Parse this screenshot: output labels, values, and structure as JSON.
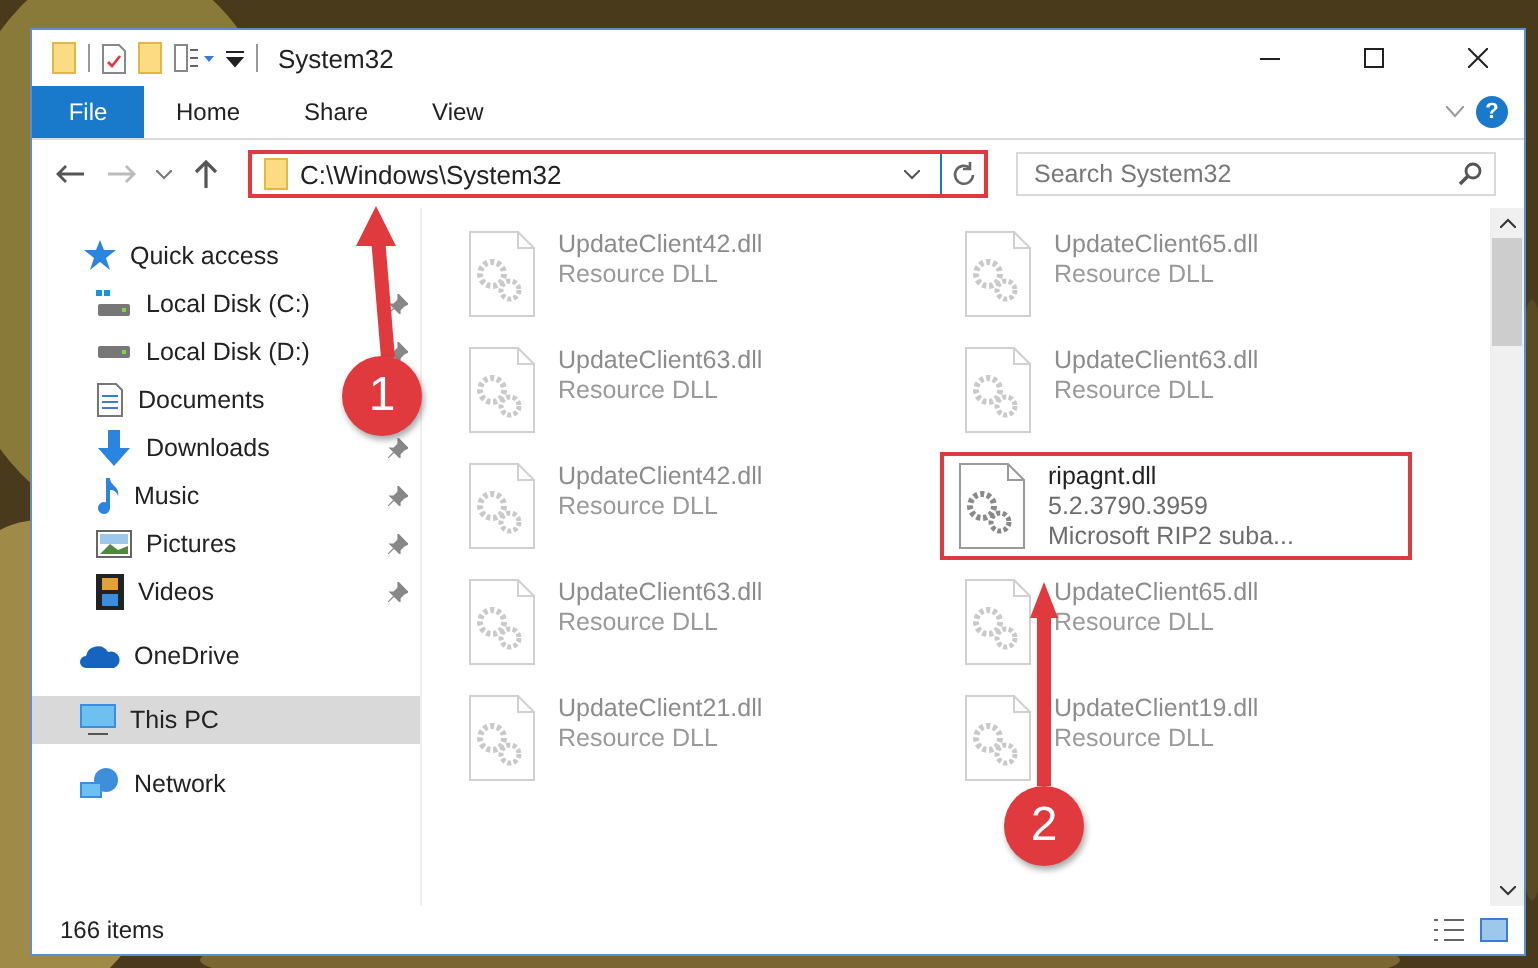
{
  "window": {
    "title": "System32"
  },
  "ribbon": {
    "tabs": [
      {
        "label": "File",
        "selected": true
      },
      {
        "label": "Home",
        "selected": false
      },
      {
        "label": "Share",
        "selected": false
      },
      {
        "label": "View",
        "selected": false
      }
    ],
    "help": "?"
  },
  "address": {
    "path": "C:\\Windows\\System32",
    "highlighted": true
  },
  "search": {
    "placeholder": "Search System32"
  },
  "sidebar": {
    "items": [
      {
        "label": "Quick access",
        "selected": false,
        "children": [
          {
            "label": "Local Disk (C:)",
            "pinned": true
          },
          {
            "label": "Local Disk (D:)",
            "pinned": true
          },
          {
            "label": "Documents",
            "pinned": false
          },
          {
            "label": "Downloads",
            "pinned": true
          },
          {
            "label": "Music",
            "pinned": true
          },
          {
            "label": "Pictures",
            "pinned": true
          },
          {
            "label": "Videos",
            "pinned": true
          }
        ]
      },
      {
        "label": "OneDrive",
        "selected": false
      },
      {
        "label": "This PC",
        "selected": true
      },
      {
        "label": "Network",
        "selected": false
      }
    ]
  },
  "files": [
    {
      "name": "UpdateClient42.dll",
      "details": [
        "Resource DLL"
      ],
      "blurred": true,
      "highlighted": false
    },
    {
      "name": "UpdateClient65.dll",
      "details": [
        "Resource DLL"
      ],
      "blurred": true,
      "highlighted": false
    },
    {
      "name": "UpdateClient63.dll",
      "details": [
        "Resource DLL"
      ],
      "blurred": true,
      "highlighted": false
    },
    {
      "name": "UpdateClient63.dll",
      "details": [
        "Resource DLL"
      ],
      "blurred": true,
      "highlighted": false
    },
    {
      "name": "UpdateClient42.dll",
      "details": [
        "Resource DLL"
      ],
      "blurred": true,
      "highlighted": false
    },
    {
      "name": "ripagnt.dll",
      "details": [
        "5.2.3790.3959",
        "Microsoft RIP2 suba..."
      ],
      "blurred": false,
      "highlighted": true
    },
    {
      "name": "UpdateClient63.dll",
      "details": [
        "Resource DLL"
      ],
      "blurred": true,
      "highlighted": false
    },
    {
      "name": "UpdateClient65.dll",
      "details": [
        "Resource DLL"
      ],
      "blurred": true,
      "highlighted": false
    },
    {
      "name": "UpdateClient21.dll",
      "details": [
        "Resource DLL"
      ],
      "blurred": true,
      "highlighted": false
    },
    {
      "name": "UpdateClient19.dll",
      "details": [
        "Resource DLL"
      ],
      "blurred": true,
      "highlighted": false
    }
  ],
  "status_bar": {
    "count": "166 items"
  },
  "annotations": [
    {
      "label": "1"
    },
    {
      "label": "2"
    }
  ]
}
